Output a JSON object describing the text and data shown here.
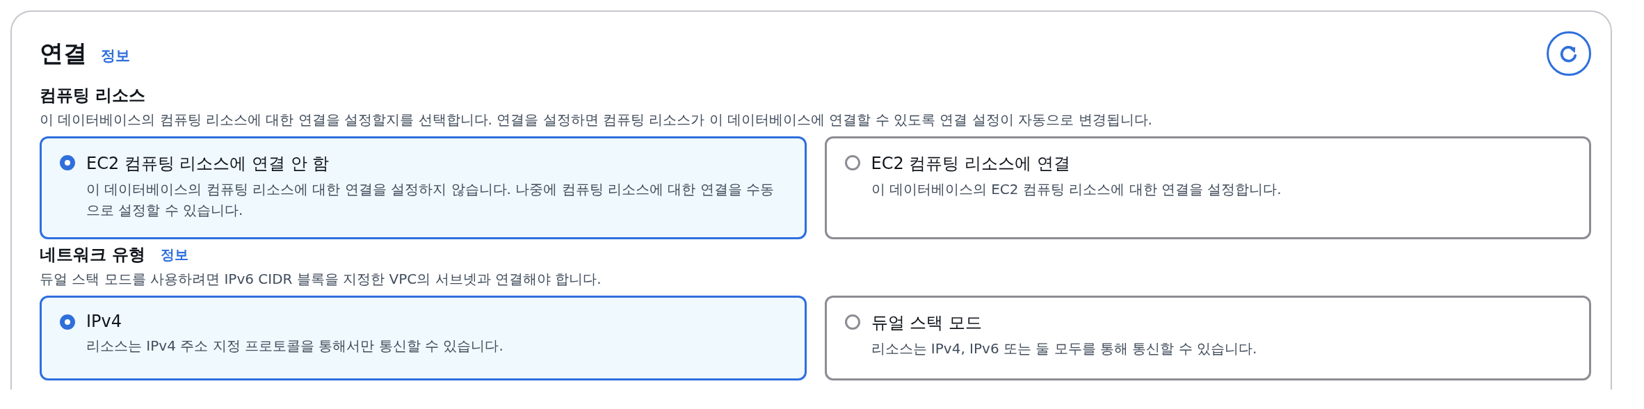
{
  "panel": {
    "title": "연결",
    "info_link": "정보"
  },
  "sections": [
    {
      "heading": "컴퓨팅 리소스",
      "description": "이 데이터베이스의 컴퓨팅 리소스에 대한 연결을 설정할지를 선택합니다. 연결을 설정하면 컴퓨팅 리소스가 이 데이터베이스에 연결할 수 있도록 연결 설정이 자동으로 변경됩니다.",
      "options": [
        {
          "label": "EC2 컴퓨팅 리소스에 연결 안 함",
          "description": "이 데이터베이스의 컴퓨팅 리소스에 대한 연결을 설정하지 않습니다. 나중에 컴퓨팅 리소스에 대한 연결을 수동으로 설정할 수 있습니다.",
          "selected": true
        },
        {
          "label": "EC2 컴퓨팅 리소스에 연결",
          "description": "이 데이터베이스의 EC2 컴퓨팅 리소스에 대한 연결을 설정합니다.",
          "selected": false
        }
      ]
    },
    {
      "heading": "네트워크 유형",
      "info_link": "정보",
      "description": "듀얼 스택 모드를 사용하려면 IPv6 CIDR 블록을 지정한 VPC의 서브넷과 연결해야 합니다.",
      "options": [
        {
          "label": "IPv4",
          "description": "리소스는 IPv4 주소 지정 프로토콜을 통해서만 통신할 수 있습니다.",
          "selected": true
        },
        {
          "label": "듀얼 스택 모드",
          "description": "리소스는 IPv4, IPv6 또는 둘 모두를 통해 통신할 수 있습니다.",
          "selected": false
        }
      ]
    }
  ]
}
